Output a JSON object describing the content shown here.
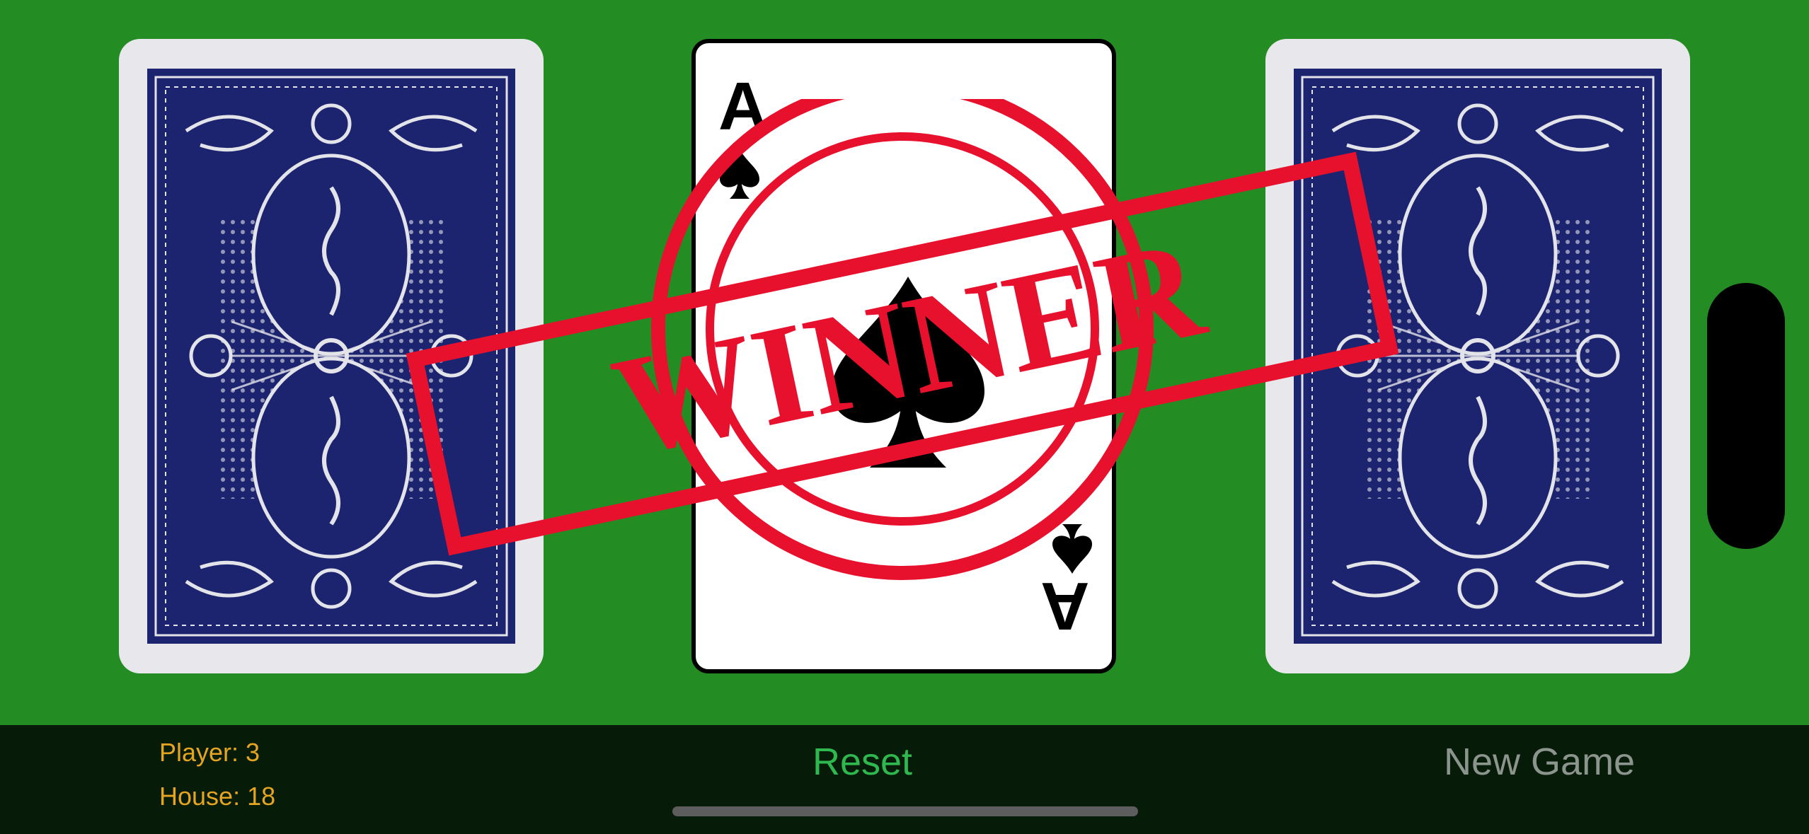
{
  "cards": {
    "left": {
      "state": "face-down"
    },
    "center": {
      "state": "face-up",
      "rank": "A",
      "suit": "spade"
    },
    "right": {
      "state": "face-down"
    }
  },
  "stamp": {
    "text": "WINNER",
    "color": "#e8112d"
  },
  "colors": {
    "table": "#238d23",
    "card_back": "#1d246f",
    "bar": "#061c08"
  },
  "scores": {
    "player": "Player: 3",
    "house": "House: 18"
  },
  "buttons": {
    "reset": "Reset",
    "new_game": "New Game"
  }
}
